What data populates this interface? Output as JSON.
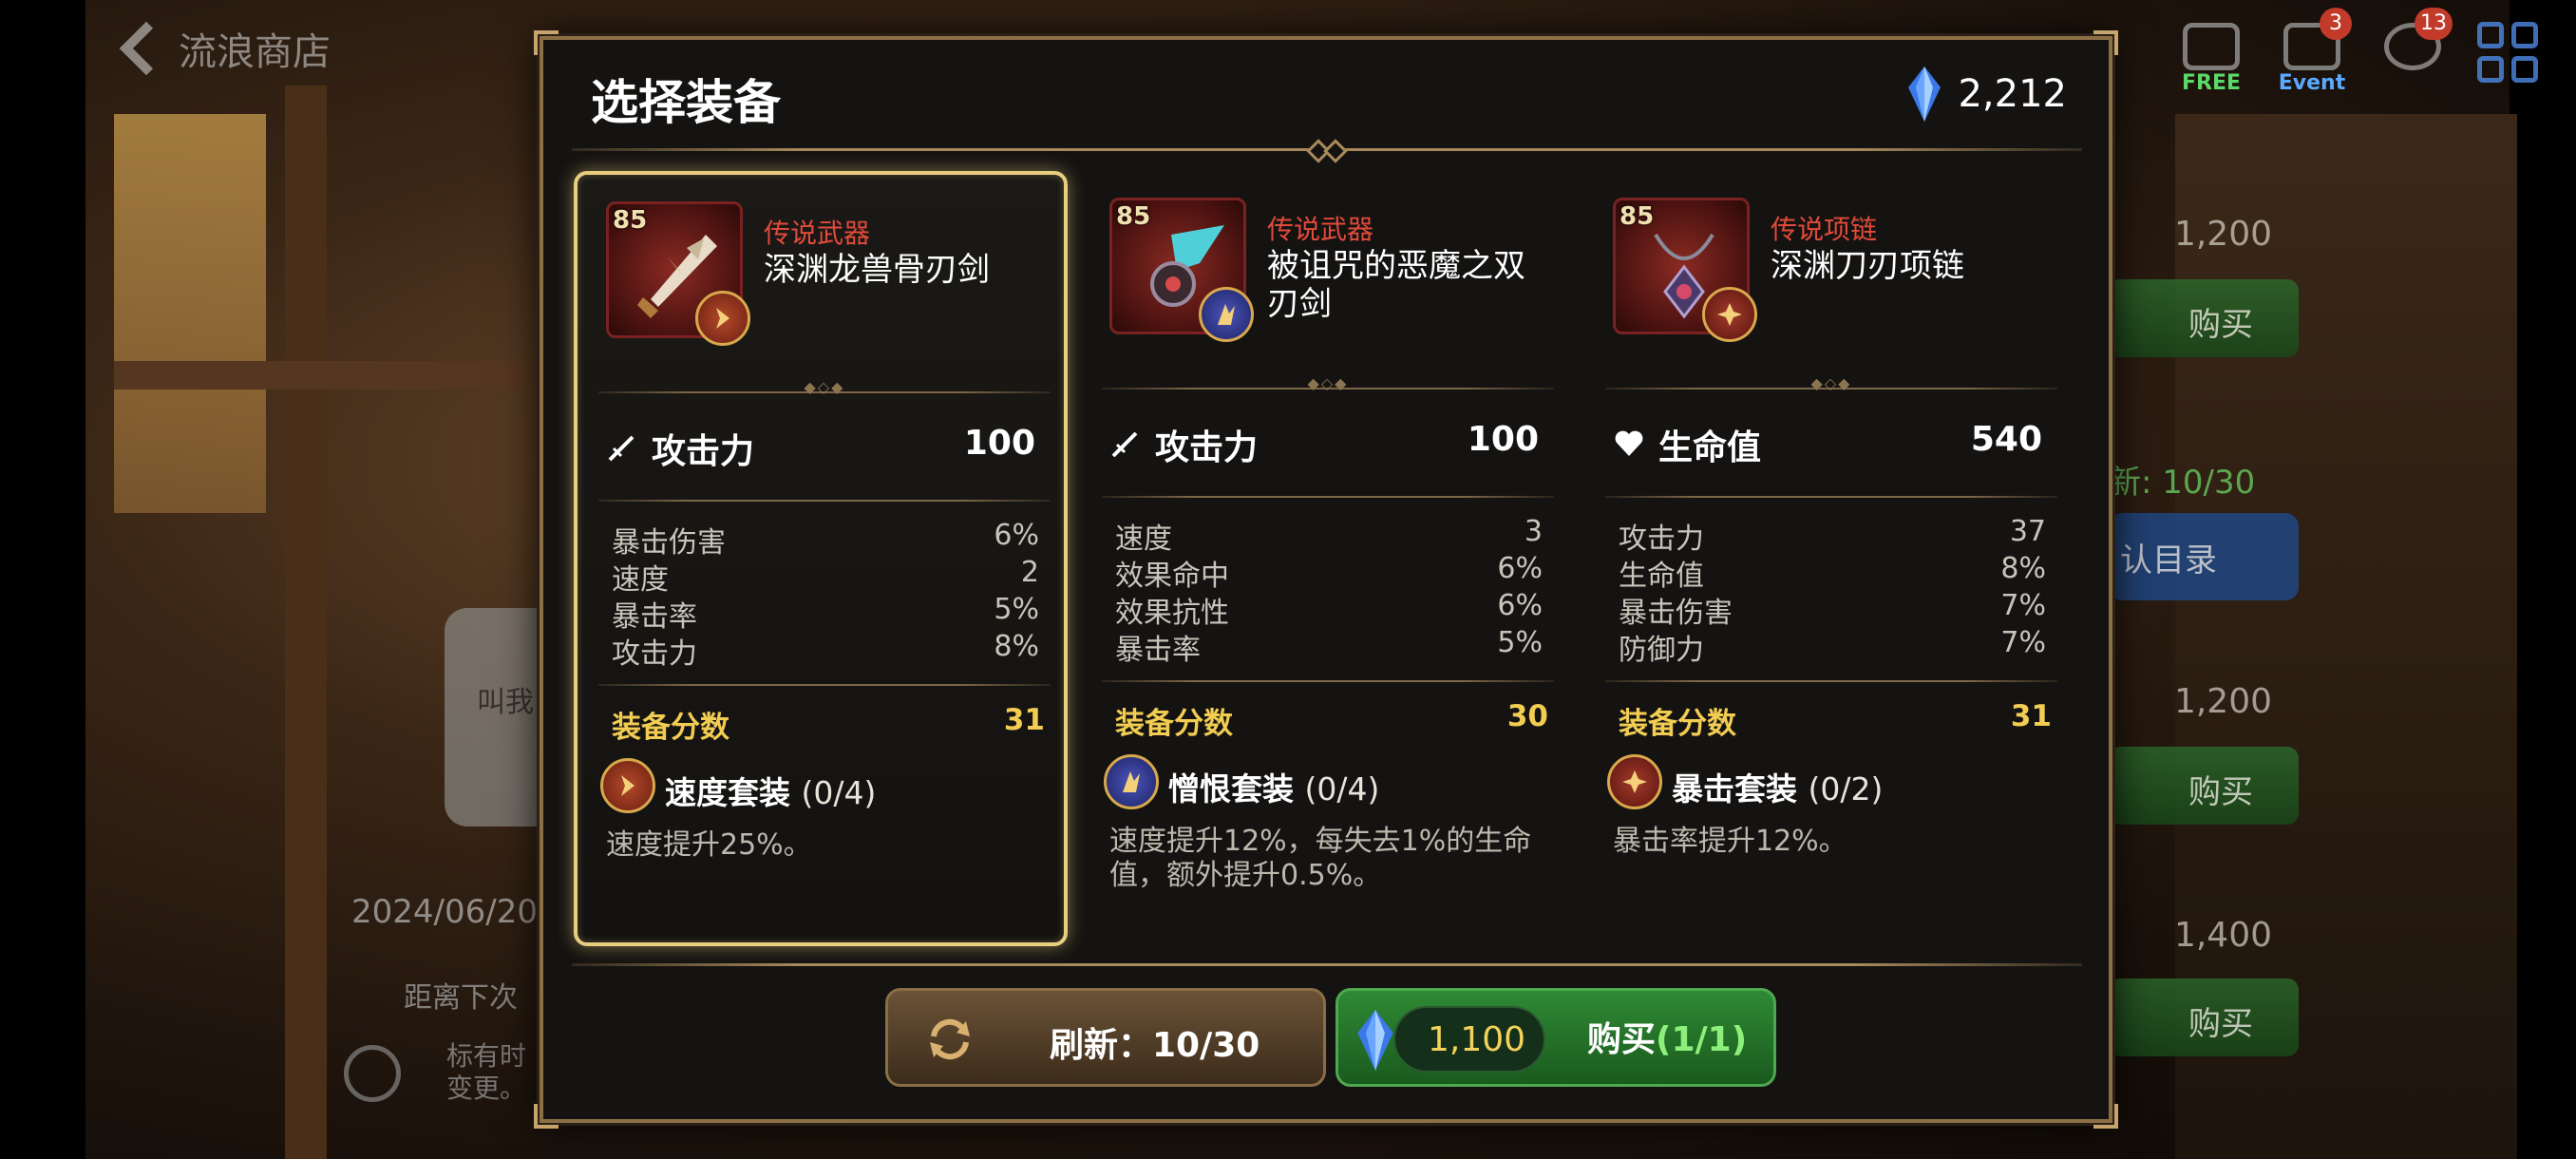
{
  "background": {
    "back_label": "流浪商店",
    "currency_partial": "212",
    "header_icons": [
      {
        "name": "free",
        "label": "FREE",
        "badge": ""
      },
      {
        "name": "event",
        "label": "Event",
        "badge": "3"
      },
      {
        "name": "chat",
        "label": "",
        "badge": "13"
      }
    ],
    "speech_text": "叫我",
    "date_text": "2024/06/20",
    "until_text": "距离下次",
    "note_text_1": "标有时",
    "note_text_2": "变更。",
    "shop_prices": [
      "1,200",
      "1,200",
      "1,400"
    ],
    "buy_label": "购买",
    "refresh_partial": "新: 10/30",
    "catalog_label": "认目录"
  },
  "modal": {
    "title": "选择装备",
    "gem_balance": "2,212",
    "cards": [
      {
        "selected": true,
        "level": "85",
        "rarity": "传说武器",
        "name": "深渊龙兽骨刃剑",
        "main_stat_icon": "sword-icon",
        "main_stat_label": "攻击力",
        "main_stat_value": "100",
        "substats": [
          {
            "k": "暴击伤害",
            "v": "6%"
          },
          {
            "k": "速度",
            "v": "2"
          },
          {
            "k": "暴击率",
            "v": "5%"
          },
          {
            "k": "攻击力",
            "v": "8%"
          }
        ],
        "score_label": "装备分数",
        "score": "31",
        "set_name": "速度套装",
        "set_count": "(0/4)",
        "set_color": "red",
        "set_desc": "速度提升25%。"
      },
      {
        "selected": false,
        "level": "85",
        "rarity": "传说武器",
        "name": "被诅咒的恶魔之双刃剑",
        "main_stat_icon": "sword-icon",
        "main_stat_label": "攻击力",
        "main_stat_value": "100",
        "substats": [
          {
            "k": "速度",
            "v": "3"
          },
          {
            "k": "效果命中",
            "v": "6%"
          },
          {
            "k": "效果抗性",
            "v": "6%"
          },
          {
            "k": "暴击率",
            "v": "5%"
          }
        ],
        "score_label": "装备分数",
        "score": "30",
        "set_name": "憎恨套装",
        "set_count": "(0/4)",
        "set_color": "blue",
        "set_desc": "速度提升12%，每失去1%的生命值，额外提升0.5%。"
      },
      {
        "selected": false,
        "level": "85",
        "rarity": "传说项链",
        "name": "深渊刀刃项链",
        "main_stat_icon": "heart-icon",
        "main_stat_label": "生命值",
        "main_stat_value": "540",
        "substats": [
          {
            "k": "攻击力",
            "v": "37"
          },
          {
            "k": "生命值",
            "v": "8%"
          },
          {
            "k": "暴击伤害",
            "v": "7%"
          },
          {
            "k": "防御力",
            "v": "7%"
          }
        ],
        "score_label": "装备分数",
        "score": "31",
        "set_name": "暴击套装",
        "set_count": "(0/2)",
        "set_color": "crim",
        "set_desc": "暴击率提升12%。"
      }
    ],
    "refresh_label": "刷新：10/30",
    "buy_price": "1,100",
    "buy_label": "购买",
    "buy_count": "(1/1)"
  },
  "colors": {
    "rarity_red": "#e24a3a",
    "score_gold": "#f2cd52",
    "buy_green": "#2f8a34",
    "frame_gold": "#e8cf80"
  }
}
